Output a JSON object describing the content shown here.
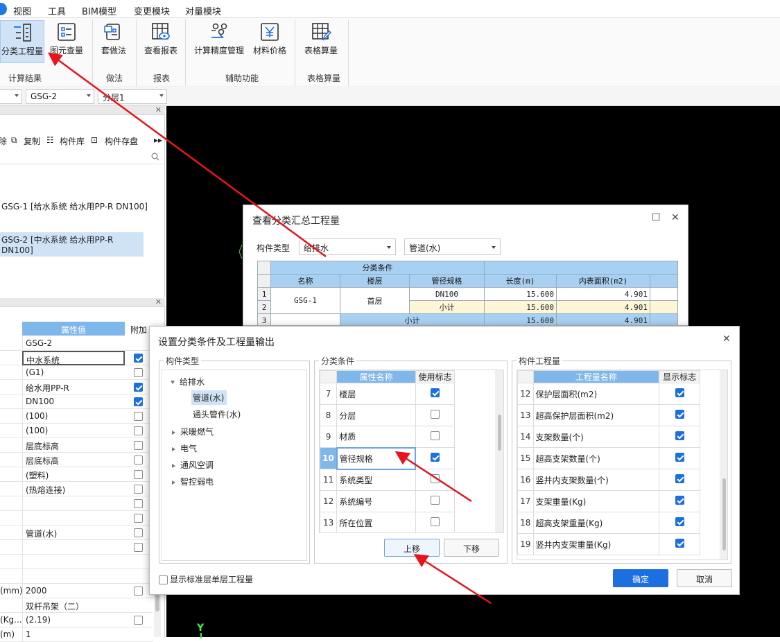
{
  "menu": [
    "视图",
    "工具",
    "BIM模型",
    "变更模块",
    "对量模块"
  ],
  "ribbon": {
    "buttons": [
      "分类工程量",
      "图元查量",
      "套做法",
      "查看报表",
      "计算精度管理",
      "材料价格",
      "表格算量"
    ],
    "groups": [
      "计算结果",
      "做法",
      "报表",
      "辅助功能",
      "表格算量"
    ]
  },
  "toolbar2": {
    "combo1": "GSG-2",
    "combo2": "分层1"
  },
  "component_panel": {
    "tools": [
      "除",
      "复制",
      "构件库",
      "构件存盘"
    ],
    "items": [
      "GSG-1 [给水系统 给水用PP-R DN100]",
      "GSG-2 [中水系统 给水用PP-R DN100]"
    ]
  },
  "props_panel": {
    "header_value": "属性值",
    "header_add": "附加",
    "rows": [
      {
        "name": "",
        "value": "GSG-2",
        "check": null
      },
      {
        "name": "",
        "value": "中水系统",
        "check": true
      },
      {
        "name": "",
        "value": "(G1)",
        "check": false
      },
      {
        "name": "",
        "value": "给水用PP-R",
        "check": true
      },
      {
        "name": "",
        "value": "DN100",
        "check": true
      },
      {
        "name": "",
        "value": "(100)",
        "check": false
      },
      {
        "name": "",
        "value": "(100)",
        "check": false
      },
      {
        "name": "",
        "value": "层底标高",
        "check": false
      },
      {
        "name": "",
        "value": "层底标高",
        "check": false
      },
      {
        "name": "",
        "value": "(塑料)",
        "check": false
      },
      {
        "name": "",
        "value": "(热熔连接)",
        "check": false
      },
      {
        "name": "",
        "value": "",
        "check": false
      },
      {
        "name": "",
        "value": "",
        "check": false
      },
      {
        "name": "",
        "value": "管道(水)",
        "check": false
      },
      {
        "name": "",
        "value": "",
        "check": false
      },
      {
        "name": "",
        "value": "",
        "check": null
      },
      {
        "name": "",
        "value": "",
        "check": null
      },
      {
        "name": "(mm)",
        "value": "2000",
        "check": false
      },
      {
        "name": "",
        "value": "双杆吊架（二）",
        "check": null
      },
      {
        "name": "(Kg...",
        "value": "(2.19)",
        "check": false
      },
      {
        "name": "(m)",
        "value": "1",
        "check": null
      }
    ]
  },
  "dlg1": {
    "title": "查看分类汇总工程量",
    "type_label": "构件类型",
    "combo1": "给排水",
    "combo2": "管道(水)",
    "group_header": "分类条件",
    "headers": [
      "名称",
      "楼层",
      "管径规格",
      "长度(m)",
      "内表面积(m2)"
    ],
    "rows": [
      {
        "n": "1",
        "spec": "DN100",
        "len": "15.600",
        "area": "4.901"
      },
      {
        "n": "2",
        "spec": "小计",
        "len": "15.600",
        "area": "4.901"
      },
      {
        "n": "3",
        "spec": "小计",
        "len": "15.600",
        "area": "4.901"
      }
    ],
    "name_cell": "GSG-1",
    "floor_cell": "首层"
  },
  "dlg2": {
    "title": "设置分类条件及工程量输出",
    "type_group": "构件类型",
    "tree": {
      "root": "给排水",
      "children": [
        "管道(水)",
        "通头管件(水)"
      ],
      "others": [
        "采暖燃气",
        "电气",
        "通风空调",
        "智控弱电"
      ]
    },
    "cond_group": "分类条件",
    "cond_headers": [
      "属性名称",
      "使用标志"
    ],
    "conditions": [
      {
        "n": "7",
        "name": "楼层",
        "on": true
      },
      {
        "n": "8",
        "name": "分层",
        "on": false
      },
      {
        "n": "9",
        "name": "材质",
        "on": false
      },
      {
        "n": "10",
        "name": "管径规格",
        "on": true
      },
      {
        "n": "11",
        "name": "系统类型",
        "on": false
      },
      {
        "n": "12",
        "name": "系统编号",
        "on": false
      },
      {
        "n": "13",
        "name": "所在位置",
        "on": false
      }
    ],
    "up_btn": "上移",
    "down_btn": "下移",
    "qty_group": "构件工程量",
    "qty_headers": [
      "工程量名称",
      "显示标志"
    ],
    "quantities": [
      {
        "n": "12",
        "name": "保护层面积(m2)",
        "on": true
      },
      {
        "n": "13",
        "name": "超高保护层面积(m2)",
        "on": true
      },
      {
        "n": "14",
        "name": "支架数量(个)",
        "on": true
      },
      {
        "n": "15",
        "name": "超高支架数量(个)",
        "on": true
      },
      {
        "n": "16",
        "name": "竖井内支架数量(个)",
        "on": true
      },
      {
        "n": "17",
        "name": "支架重量(Kg)",
        "on": true
      },
      {
        "n": "18",
        "name": "超高支架重量(Kg)",
        "on": true
      },
      {
        "n": "19",
        "name": "竖井内支架重量(Kg)",
        "on": true
      }
    ],
    "std_floor_label": "显示标准层单层工程量",
    "ok": "确定",
    "cancel": "取消"
  },
  "canvas_axis_label": "Y",
  "colors": {
    "accent": "#1c6fe0",
    "header": "#7fb7ea",
    "annotation": "#e8141b"
  }
}
